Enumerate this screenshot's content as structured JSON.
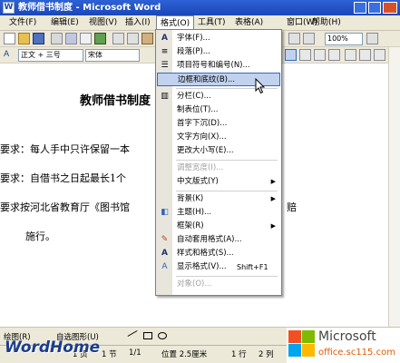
{
  "window": {
    "title": "教师借书制度 - Microsoft Word"
  },
  "menubar": [
    {
      "label": "文件(F)"
    },
    {
      "label": "编辑(E)"
    },
    {
      "label": "视图(V)"
    },
    {
      "label": "插入(I)"
    },
    {
      "label": "格式(O)"
    },
    {
      "label": "工具(T)"
    },
    {
      "label": "表格(A)"
    },
    {
      "label": "窗口(W)"
    },
    {
      "label": "帮助(H)"
    }
  ],
  "toolbar": {
    "zoom": "100%",
    "style": "正文 + 三号",
    "font": "宋体"
  },
  "document": {
    "lines": [
      "教师借书制度",
      "要求：每人手中只许保留一本",
      "要求：自借书之日起最长1个",
      "要求按河北省教育厅《图书馆",
      "施行。"
    ],
    "tail_fragment": "赔"
  },
  "format_menu": {
    "items": [
      {
        "label": "字体(F)...",
        "icon": "font-icon"
      },
      {
        "label": "段落(P)...",
        "icon": "paragraph-icon"
      },
      {
        "label": "项目符号和编号(N)...",
        "icon": "bullets-icon"
      },
      {
        "label": "边框和底纹(B)...",
        "highlight": true
      },
      {
        "label": "分栏(C)...",
        "icon": "columns-icon"
      },
      {
        "label": "制表位(T)..."
      },
      {
        "label": "首字下沉(D)..."
      },
      {
        "label": "文字方向(X)..."
      },
      {
        "label": "更改大小写(E)..."
      },
      {
        "label": "调整宽度(I)...",
        "disabled": true
      },
      {
        "label": "中文版式(Y)",
        "submenu": true
      },
      {
        "label": "背景(K)",
        "submenu": true
      },
      {
        "label": "主题(H)...",
        "icon": "theme-icon"
      },
      {
        "label": "框架(R)",
        "submenu": true
      },
      {
        "label": "自动套用格式(A)...",
        "icon": "autoformat-icon"
      },
      {
        "label": "样式和格式(S)...",
        "icon": "styles-icon"
      },
      {
        "label": "显示格式(V)...",
        "icon": "reveal-format-icon",
        "shortcut": "Shift+F1"
      },
      {
        "label": "对象(O)...",
        "disabled": true
      }
    ]
  },
  "drawbar": {
    "draw_label": "绘图(R)",
    "autoshapes_label": "自选图形(U)"
  },
  "status": {
    "page": "1 页",
    "section": "1 节",
    "pages": "1/1",
    "position": "位置 2.5厘米",
    "line": "1 行",
    "col": "2 列"
  },
  "watermark": {
    "left": "WordHome",
    "brand": "Microsoft",
    "site": "office.sc115.com"
  },
  "colors": {
    "title_bar": "#1b47b8",
    "menu_highlight": "#c1d2ee",
    "menu_bg": "#ece9d8",
    "brand_orange": "#f25022"
  }
}
